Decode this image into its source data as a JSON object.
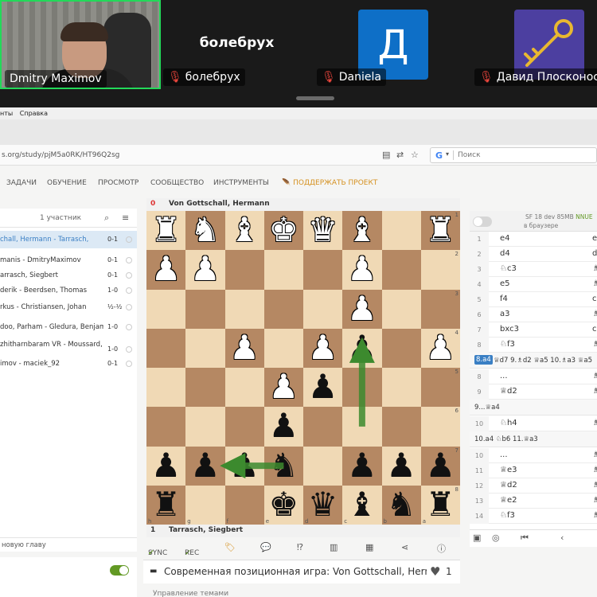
{
  "zoom": {
    "participants": [
      {
        "name": "Dmitry Maximov"
      },
      {
        "name": "болебрух",
        "center_name": "болебрух"
      },
      {
        "name": "Daniela",
        "avatar_letter": "Д",
        "avatar_color": "#0e6fc7"
      },
      {
        "name": "Давид Плосконос",
        "avatar_color": "#4c3fa0"
      }
    ],
    "active_speaker_color": "#23d959"
  },
  "browser": {
    "menu": [
      "нты",
      "Справка"
    ],
    "url": "s.org/study/pjM5a0RK/HT96Q2sg",
    "search_placeholder": "Поиск",
    "search_engine": "G"
  },
  "site_nav": {
    "items": [
      "ЗАДАЧИ",
      "ОБУЧЕНИЕ",
      "ПРОСМОТР",
      "СООБЩЕСТВО",
      "ИНСТРУМЕНТЫ"
    ],
    "donate": "ПОДДЕРЖАТЬ ПРОЕКТ"
  },
  "study": {
    "members": "1 участник",
    "chapters": [
      {
        "title": "chall, Hermann - Tarrasch,",
        "result": "0-1",
        "active": true
      },
      {
        "title": "manis - DmitryMaximov",
        "result": "0-1"
      },
      {
        "title": "arrasch, Siegbert",
        "result": "0-1"
      },
      {
        "title": "derik - Beerdsen, Thomas",
        "result": "1-0"
      },
      {
        "title": "rkus - Christiansen, Johan",
        "result": "½-½"
      },
      {
        "title": "doo, Parham - Gledura, Benjamin",
        "result": "1-0"
      },
      {
        "title": "zhitharnbaram VR - Moussard,",
        "result": "1-0"
      },
      {
        "title": "imov - maciek_92",
        "result": "0-1"
      }
    ],
    "new_chapter": "новую главу",
    "title": "Современная позиционная игра: Von Gottschall, Hermann - Tarrasch, Siegbert",
    "likes": "1",
    "topics": "Управление темами"
  },
  "game": {
    "top_player": "Von Gottschall, Hermann",
    "top_clock": "0",
    "bottom_player": "Tarrasch, Siegbert",
    "bottom_clock": "1",
    "board_light": "#f0d9b5",
    "board_dark": "#b58863",
    "arrow_color": "#3c8a2e",
    "ranks": [
      "1",
      "2",
      "3",
      "4",
      "5",
      "6",
      "7",
      "8"
    ],
    "files": [
      "h",
      "g",
      "f",
      "e",
      "d",
      "c",
      "b",
      "a"
    ],
    "position": [
      [
        "wR",
        "wN",
        "wB",
        "wK",
        "wQ",
        "wB",
        "",
        ""
      ],
      [
        "wP",
        "wP",
        "",
        "",
        "",
        "wP",
        "",
        ""
      ],
      [
        "",
        "",
        "",
        "",
        "",
        "wP",
        "",
        ""
      ],
      [
        "",
        "",
        "wP",
        "",
        "wP",
        "bP",
        "",
        "wP"
      ],
      [
        "",
        "",
        "",
        "wP",
        "bP",
        "",
        "",
        ""
      ],
      [
        "",
        "",
        "",
        "bP",
        "",
        "",
        "",
        ""
      ],
      [
        "bP",
        "bP",
        "bP",
        "bN",
        "",
        "bP",
        "bP",
        "bP"
      ],
      [
        "bR",
        "",
        "",
        "bK",
        "bQ",
        "bB",
        "bN",
        "bR"
      ]
    ],
    "extra_top_right_rook": true,
    "arrows": [
      {
        "from": [
          5,
          5
        ],
        "to": [
          2,
          5
        ]
      },
      {
        "from": [
          6,
          3
        ],
        "to": [
          6,
          1
        ]
      }
    ]
  },
  "tools": {
    "sync": "SYNC",
    "rec": "REC"
  },
  "engine": {
    "name": "SF 18 dev 85MB",
    "nnue": "NNUE",
    "location": "в браузере"
  },
  "moves": [
    {
      "n": "1",
      "w": "e4",
      "b": "e"
    },
    {
      "n": "2",
      "w": "d4",
      "b": "d"
    },
    {
      "n": "3",
      "w": "♘c3",
      "b": "♗"
    },
    {
      "n": "4",
      "w": "e5",
      "b": "♗"
    },
    {
      "n": "5",
      "w": "f4",
      "b": "c"
    },
    {
      "n": "6",
      "w": "a3",
      "b": "♗"
    },
    {
      "n": "7",
      "w": "bxc3",
      "b": "c"
    },
    {
      "n": "8",
      "w": "♘f3",
      "b": "♗"
    }
  ],
  "variation1": {
    "hl": "8.a4",
    "rest": "♕d7 9.♗d2 ♕a5 10.♗a3 ♕a5"
  },
  "moves2": [
    {
      "n": "8",
      "w": "...",
      "b": "♗"
    },
    {
      "n": "9",
      "w": "♕d2",
      "b": "♗"
    }
  ],
  "variation2": {
    "text": "9...♕a4"
  },
  "moves3": [
    {
      "n": "10",
      "w": "♘h4",
      "b": "♗"
    }
  ],
  "variation3": {
    "text": "10.a4 ♘b6 11.♕a3"
  },
  "moves4": [
    {
      "n": "10",
      "w": "...",
      "b": "♗"
    },
    {
      "n": "11",
      "w": "♕e3",
      "b": "♗"
    },
    {
      "n": "12",
      "w": "♕d2",
      "b": "♗"
    },
    {
      "n": "13",
      "w": "♕e2",
      "b": "♗"
    },
    {
      "n": "14",
      "w": "♘f3",
      "b": "♗"
    }
  ]
}
